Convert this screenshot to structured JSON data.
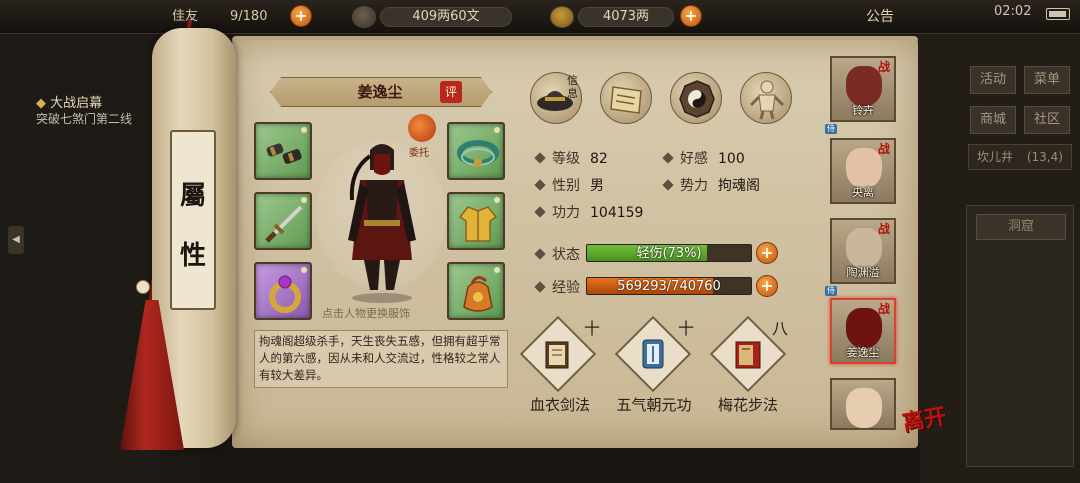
{
  "topbar": {
    "capacity_value": "9/180",
    "currency1": "409两60文",
    "currency2": "4073两",
    "notice_label": "公告",
    "clock": "02:02"
  },
  "left_panel": {
    "quest_title": "大战启幕",
    "quest_desc": "突破七煞门第二线"
  },
  "scroll": {
    "rod_label_line1": "屬",
    "rod_label_line2": "性"
  },
  "character": {
    "name": "姜逸尘",
    "eval_badge": "评",
    "delegate_label": "委托",
    "change_outfit_hint": "点击人物更换服饰",
    "description": "拘魂阁超级杀手，天生丧失五感，但拥有超乎常人的第六感，因从未和人交流过，性格较之常人有较大差异。"
  },
  "tabs": {
    "active_label": "信息"
  },
  "stats": {
    "level_label": "等级",
    "level_value": "82",
    "favor_label": "好感",
    "favor_value": "100",
    "gender_label": "性别",
    "gender_value": "男",
    "faction_label": "势力",
    "faction_value": "拘魂阁",
    "power_label": "功力",
    "power_value": "104159",
    "state_label": "状态",
    "state_text": "轻伤(73%)",
    "state_fraction": 0.73,
    "exp_label": "经验",
    "exp_text": "569293/740760",
    "exp_fraction": 0.7685
  },
  "skills": [
    {
      "name": "血衣剑法",
      "level": "十"
    },
    {
      "name": "五气朝元功",
      "level": "十"
    },
    {
      "name": "梅花步法",
      "level": "八"
    }
  ],
  "roster": [
    {
      "name": "铃卉",
      "tag": "战"
    },
    {
      "name": "央离",
      "tag": "战"
    },
    {
      "name": "陶渊溢",
      "tag": "战"
    },
    {
      "name": "姜逸尘",
      "tag": "战"
    },
    {
      "name": "",
      "tag": ""
    }
  ],
  "right_menu": {
    "activity": "活动",
    "menu": "菜单",
    "shop": "商城",
    "community": "社区",
    "location": "坎儿井",
    "coords": "(13,4)",
    "cave": "洞窟"
  },
  "leave_label": "离开",
  "colors": {
    "state_bar": "#6fbf3a",
    "exp_bar": "#e7731c",
    "accent_red": "#b8261c",
    "parchment": "#d4c5a6"
  }
}
